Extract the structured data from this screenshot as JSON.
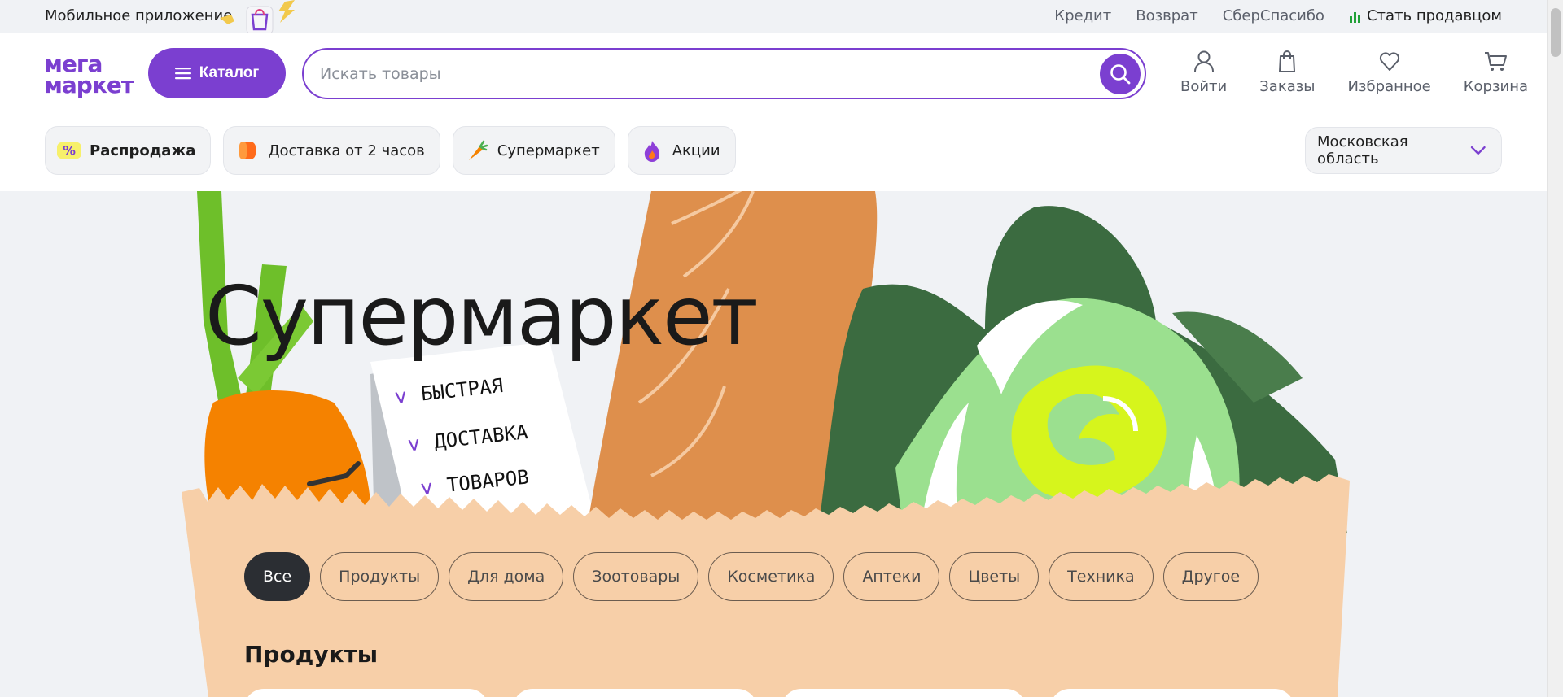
{
  "topbar": {
    "app_link": "Мобильное приложение",
    "links": [
      "Кредит",
      "Возврат",
      "СберСпасибо"
    ],
    "seller_link": "Стать продавцом"
  },
  "header": {
    "logo_line1": "мега",
    "logo_line2": "маркет",
    "catalog_label": "Каталог",
    "search_placeholder": "Искать товары",
    "nav": {
      "login": "Войти",
      "orders": "Заказы",
      "favorites": "Избранное",
      "cart": "Корзина"
    },
    "chips": {
      "sale": "Распродажа",
      "delivery": "Доставка от 2 часов",
      "supermarket": "Супермаркет",
      "promo": "Акции"
    },
    "region": "Московская область"
  },
  "hero": {
    "title": "Супермаркет",
    "note_lines": [
      "БЫСТРАЯ",
      "ДОСТАВКА",
      "ТОВАРОВ"
    ],
    "note_tick": "v"
  },
  "filters": [
    "Все",
    "Продукты",
    "Для дома",
    "Зоотовары",
    "Косметика",
    "Аптеки",
    "Цветы",
    "Техника",
    "Другое"
  ],
  "active_filter": "Все",
  "section_title": "Продукты",
  "colors": {
    "brand": "#7b3fd0",
    "bag": "#f7cfa8",
    "carrot": "#f58200",
    "bread": "#de8f4c",
    "greens_dark": "#3b6b40",
    "greens_light": "#9be08f",
    "lime": "#d6f51c"
  }
}
